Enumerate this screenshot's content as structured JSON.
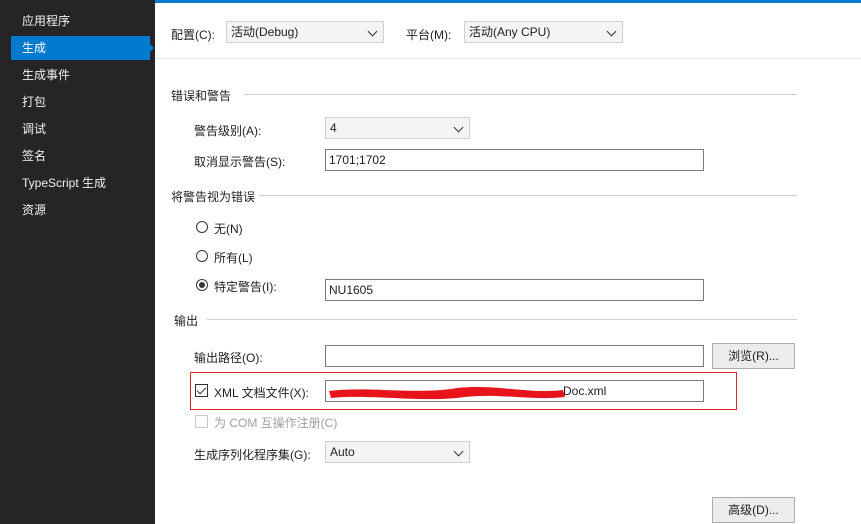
{
  "sidebar": {
    "items": [
      {
        "label": "应用程序"
      },
      {
        "label": "生成"
      },
      {
        "label": "生成事件"
      },
      {
        "label": "打包"
      },
      {
        "label": "调试"
      },
      {
        "label": "签名"
      },
      {
        "label": "TypeScript 生成"
      },
      {
        "label": "资源"
      }
    ],
    "active_index": 1
  },
  "config": {
    "config_label": "配置(C):",
    "config_value": "活动(Debug)",
    "platform_label": "平台(M):",
    "platform_value": "活动(Any CPU)"
  },
  "errors_section": {
    "title": "错误和警告",
    "warning_level_label": "警告级别(A):",
    "warning_level_value": "4",
    "suppress_label": "取消显示警告(S):",
    "suppress_value": "1701;1702"
  },
  "treat_section": {
    "title": "将警告视为错误",
    "none_label": "无(N)",
    "all_label": "所有(L)",
    "specific_label": "特定警告(I):",
    "specific_value": "NU1605",
    "selected": "specific"
  },
  "output_section": {
    "title": "输出",
    "path_label": "输出路径(O):",
    "path_value": "",
    "browse_label": "浏览(R)...",
    "xml_label": "XML 文档文件(X):",
    "xml_checked": true,
    "xml_value": "Doc.xml",
    "com_label": "为 COM 互操作注册(C)",
    "com_checked": false,
    "serialization_label": "生成序列化程序集(G):",
    "serialization_value": "Auto",
    "advanced_label": "高级(D)..."
  },
  "colors": {
    "accent": "#007acc",
    "sidebar_bg": "#252526",
    "highlight": "#e0242b"
  }
}
